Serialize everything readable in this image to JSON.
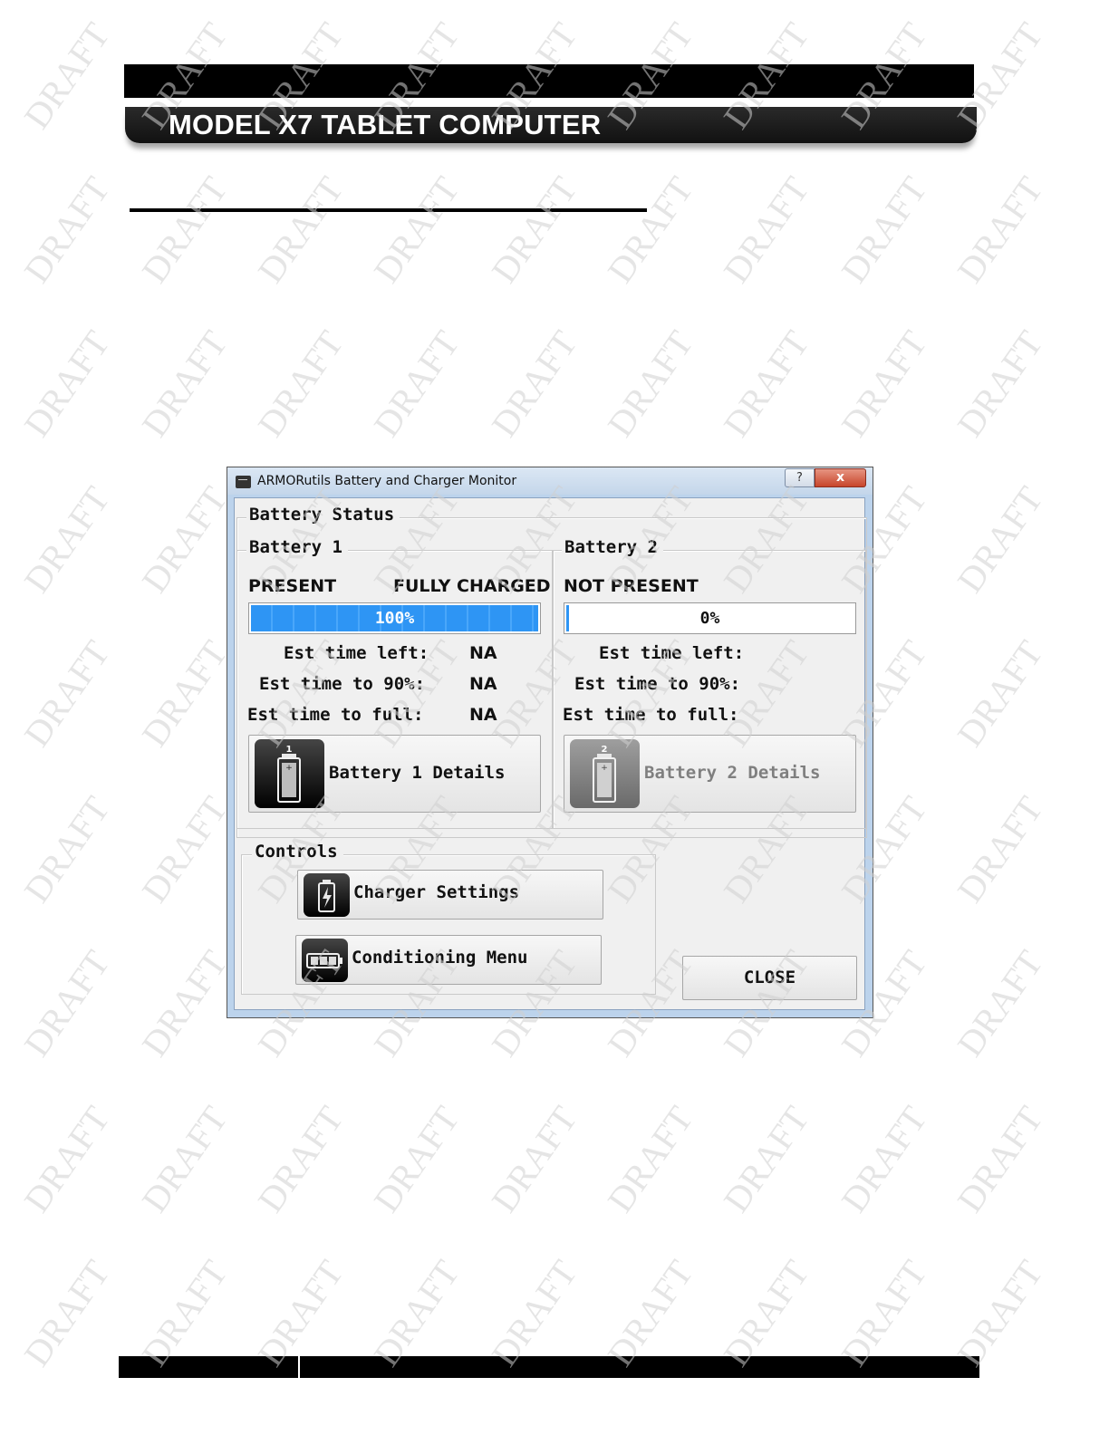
{
  "header": {
    "title": "MODEL X7 TABLET COMPUTER"
  },
  "watermark": {
    "text": "DRAFT"
  },
  "dialog": {
    "title": "ARMORutils Battery and Charger Monitor",
    "help_label": "?",
    "close_x_label": "x",
    "battery_status_label": "Battery Status",
    "battery1": {
      "label": "Battery 1",
      "presence": "PRESENT",
      "charge_state": "FULLY CHARGED",
      "percent_label": "100%",
      "percent_value": 100,
      "est_time_left_label": "Est time left:",
      "est_time_left_value": "NA",
      "est_time_90_label": "Est time to 90%:",
      "est_time_90_value": "NA",
      "est_time_full_label": "Est time to full:",
      "est_time_full_value": "NA",
      "details_label": "Battery 1 Details",
      "icon_number": "1"
    },
    "battery2": {
      "label": "Battery 2",
      "presence": "NOT PRESENT",
      "percent_label": "0%",
      "percent_value": 0,
      "est_time_left_label": "Est time left:",
      "est_time_90_label": "Est time to 90%:",
      "est_time_full_label": "Est time to full:",
      "details_label": "Battery 2 Details",
      "icon_number": "2"
    },
    "controls": {
      "label": "Controls",
      "charger_settings_label": "Charger Settings",
      "conditioning_menu_label": "Conditioning Menu"
    },
    "close_button_label": "CLOSE"
  }
}
